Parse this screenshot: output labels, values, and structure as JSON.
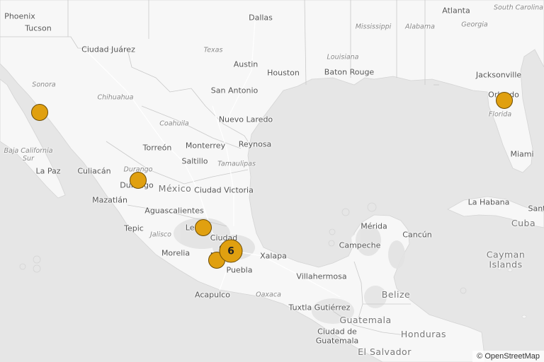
{
  "map": {
    "colors": {
      "land": "#f7f7f7",
      "water": "#e6e6e6",
      "marker_fill": "#E0A010",
      "marker_stroke": "#6b4c08"
    },
    "attribution": "© OpenStreetMap",
    "labels": {
      "phoenix": "Phoenix",
      "tucson": "Tucson",
      "dallas": "Dallas",
      "atlanta": "Atlanta",
      "south_carolina": "South Carolina",
      "georgia": "Georgia",
      "mississippi": "Mississippi",
      "alabama": "Alabama",
      "louisiana": "Louisiana",
      "baton_rouge": "Baton Rouge",
      "ciudad_juarez": "Ciudad Juárez",
      "texas": "Texas",
      "austin": "Austin",
      "houston": "Houston",
      "san_antonio": "San Antonio",
      "jacksonville": "Jacksonville",
      "orlando": "Orlando",
      "florida": "Florida",
      "miami": "Miami",
      "sonora": "Sonora",
      "chihuahua": "Chihuahua",
      "nuevo_laredo": "Nuevo Laredo",
      "coahuila": "Coahuila",
      "reynosa": "Reynosa",
      "baja_california_sur": "Baja California Sur",
      "torreon": "Torreón",
      "monterrey": "Monterrey",
      "saltillo": "Saltillo",
      "tamaulipas": "Tamaulipas",
      "la_paz": "La Paz",
      "culiacan": "Culiacán",
      "durango_state": "Durango",
      "durango": "Durango",
      "mexico": "México",
      "ciudad_victoria": "Ciudad Victoria",
      "mazatlan": "Mazatlán",
      "aguascalientes": "Aguascalientes",
      "la_habana": "La Habana",
      "santa_clara": "Sant",
      "cuba": "Cuba",
      "tepic": "Tepic",
      "jalisco": "Jalisco",
      "leon": "León",
      "merida": "Mérida",
      "cancun": "Cancún",
      "ciudad_de_mexico": "Ciudad de México",
      "campeche": "Campeche",
      "cayman_islands": "Cayman Islands",
      "morelia": "Morelia",
      "xalapa": "Xalapa",
      "puebla": "Puebla",
      "villahermosa": "Villahermosa",
      "belize": "Belize",
      "acapulco": "Acapulco",
      "oaxaca": "Oaxaca",
      "tuxtla": "Tuxtla Gutiérrez",
      "guatemala": "Guatemala",
      "ciudad_de_guatemala": "Ciudad de Guatemala",
      "honduras": "Honduras",
      "el_salvador": "El Salvador"
    },
    "markers": [
      {
        "name": "marker-sonora",
        "type": "single"
      },
      {
        "name": "marker-durango",
        "type": "single"
      },
      {
        "name": "marker-leon",
        "type": "single"
      },
      {
        "name": "marker-cluster-mexico-city",
        "type": "cluster",
        "count": "6"
      },
      {
        "name": "marker-morelos",
        "type": "single"
      },
      {
        "name": "marker-orlando",
        "type": "single"
      }
    ]
  }
}
